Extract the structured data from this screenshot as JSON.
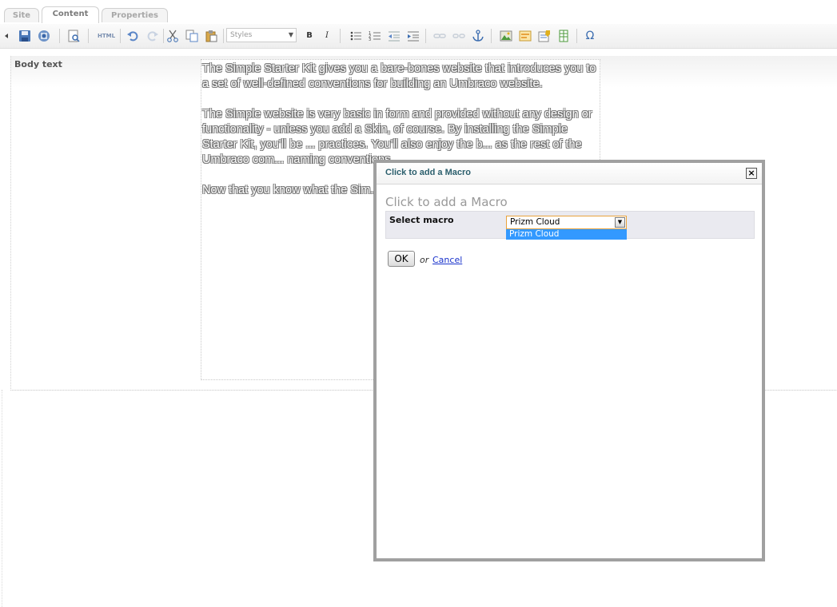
{
  "tabs": [
    {
      "label": "Site",
      "active": false
    },
    {
      "label": "Content",
      "active": true
    },
    {
      "label": "Properties",
      "active": false
    }
  ],
  "toolbar": {
    "styles_select": "Styles",
    "icons": [
      "arrow-left-icon",
      "save-icon",
      "save-publish-icon",
      "preview-icon",
      "html-source-icon",
      "undo-icon",
      "redo-icon",
      "cut-icon",
      "copy-icon",
      "paste-icon",
      "bold-icon",
      "italic-icon",
      "bullet-list-icon",
      "numbered-list-icon",
      "outdent-icon",
      "indent-icon",
      "link-icon",
      "unlink-icon",
      "anchor-icon",
      "insert-image-icon",
      "insert-macro-icon",
      "insert-form-icon",
      "insert-table-icon",
      "special-character-icon"
    ],
    "html_label": "HTML",
    "bold_label": "B",
    "italic_label": "I",
    "omega_label": "Ω"
  },
  "property": {
    "label": "Body text",
    "paragraphs": [
      "The Simple Starter Kit gives you a bare-bones website that introduces you to a set of well-defined conventions for building an Umbraco website.",
      "The Simple website is very basic in form and provided without any design or functionality - unless you add a Skin, of course. By installing the Simple Starter Kit, you'll be ... practices. You'll also enjoy the b... as the rest of the Umbraco com... naming conventions.",
      "Now that you know what the Sim... Umbraco."
    ]
  },
  "modal": {
    "title": "Click to add a Macro",
    "close_label": "×",
    "heading": "Click to add a Macro",
    "select_label": "Select macro",
    "selected_value": "Prizm Cloud",
    "options": [
      "Prizm Cloud"
    ],
    "ok_label": "OK",
    "or_text": "or",
    "cancel_label": "Cancel"
  }
}
